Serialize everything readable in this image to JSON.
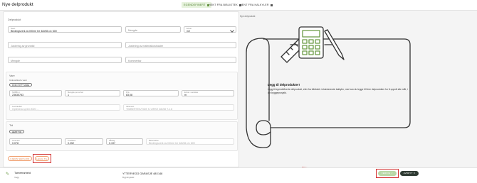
{
  "header": {
    "title": "Nye delprodukt",
    "tabs": [
      {
        "label": "EGENDEFINERT",
        "icon": "list-icon"
      },
      {
        "label": "HENT FRA BIBLIOTEK",
        "icon": "book-icon"
      },
      {
        "label": "HENT FRA KALKYLER",
        "icon": "calculator-icon"
      }
    ]
  },
  "form": {
    "section_title": "Delprodukt",
    "navn": {
      "label": "Navn",
      "value": "Bindingsverk av fellere tre 48x98 c/c 600"
    },
    "mengde": {
      "placeholder": "Mengde"
    },
    "enhet": {
      "label": "Enhet",
      "value": "m2"
    },
    "justering_gruntid": {
      "placeholder": "Justering av grunntid"
    },
    "justering_material": {
      "placeholder": "Justering av materialkostnader"
    },
    "mengde2": {
      "placeholder": "Mengde"
    },
    "kommentar": {
      "placeholder": "Kommentar"
    },
    "varer": {
      "title": "Vare",
      "link": "Innkoordinerte varer",
      "chip": "FINN / BYTT VARE",
      "nobb": {
        "label": "NOBB nr.",
        "value": "23635783"
      },
      "mengde": {
        "label": "Mengde per enhet",
        "value": "1"
      },
      "pris": {
        "label": "Pris",
        "value": "83,08"
      },
      "enhet": {
        "label": "Enhet i vareliste",
        "value": "m"
      },
      "info1": {
        "label": "Leverandør",
        "value": "Optimera sprint 2020 ..."
      },
      "info2": {
        "label": "Varenavn",
        "value": "TIMBERTEK/VIDE K-VIRKE 48x98 T-1.8"
      }
    },
    "tid": {
      "title": "Tid",
      "chip": "HENT TID",
      "f1": {
        "label": "Grunntid",
        "value": "0.078"
      },
      "f2": {
        "label": "Prisfaktor",
        "value": "0.252"
      },
      "f3": {
        "label": "Påslag",
        "value": "0.197"
      },
      "f4": {
        "label": "Beskrivelse",
        "value": "Bindingsverk av fellere tre 48x98 c/c 600"
      }
    },
    "buttons": {
      "avbryt": "FJERN SEKSJON",
      "legg_til": "LEGG TIL"
    }
  },
  "right": {
    "note": "Nye delprodukt",
    "info_title": "Legg til delprodukter!",
    "info_text": "Legg til egendefinerte delprodukt, eller fra bibliotek i eksisterende kalkyler, mer kan du legge til flere delprodukter for å oppnå alle mål, i din byggeprosjekt."
  },
  "bottom_bar": {
    "item_title": "Tømrerarbeid",
    "item_sub": "Vegg",
    "project_title": "YTTERVEGG GARASJE 48X148",
    "project_sub": "Bygningsdel",
    "ferdig": "FERDIG",
    "avbryt": "AVBRYT"
  },
  "colors": {
    "accent_green": "#6b9b45",
    "annotation_red": "#d3302f",
    "orange": "#e07b3c"
  }
}
